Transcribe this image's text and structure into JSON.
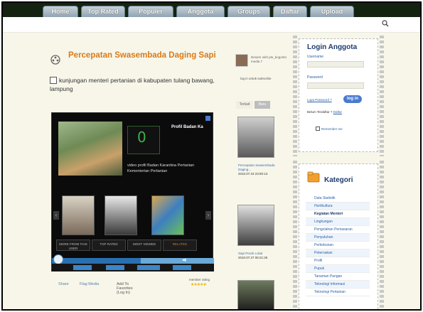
{
  "nav": {
    "tabs": [
      "Home",
      "Top Rated",
      "Populer",
      "Anggota",
      "Groups",
      "Daftar",
      "Upload"
    ]
  },
  "video": {
    "title": "Percepatan Swasembada Daging Sapi",
    "description": "kunjungan menteri pertanian di kabupaten tulang bawang, lampung"
  },
  "player": {
    "profile_title": "Profil Badan Ka",
    "featured_caption": "video profil Badan Karantina Pertanian Kementerian Pertanian",
    "tabs": [
      "MORE FROM THIS USER",
      "TOP RATED",
      "MOST VIEWED",
      "RELATED"
    ],
    "progress": 0.55
  },
  "below_player": {
    "share": "Share",
    "flag": "Flag Media",
    "add_favorites": "Add To Favorites (Log In)",
    "member_rating": "member rating",
    "stars": "★★★★★"
  },
  "uploader": {
    "text": "Desem oleh pts_bogortin media 7",
    "login_subscribe": "log in untuk subscribe"
  },
  "side_tabs": [
    "Terkait",
    "Baru"
  ],
  "side_videos": [
    {
      "title": "Percepatan Swasembada Daging...",
      "date": "2010.07.23 23:50:13"
    },
    {
      "title": "Sapi Perah Lokal",
      "date": "2010.07.27 06:21:26"
    }
  ],
  "login": {
    "title": "Login Anggota",
    "username_label": "Username",
    "password_label": "Password",
    "forgot": "Lupa Password ?",
    "button": "log in",
    "register_text": "Belum Terdaftar ?",
    "register_link": "Daftar",
    "remember": "Remember me"
  },
  "kategori": {
    "title": "Kategori",
    "items": [
      "Data Statistik",
      "Hortikultura",
      "Kegiatan Menteri",
      "Lingkungan",
      "Pengolahan Pemasaran",
      "Penyuluhan",
      "Perkebunan",
      "Peternakan",
      "Profil",
      "Pupuk",
      "Tanaman Pangan",
      "Teknologi Informasi",
      "Teknologi Pertanian"
    ]
  },
  "colors": {
    "nav_bg": "#14230f",
    "title_orange": "#d97a1a",
    "link_blue": "#2a5fa8",
    "page_bg": "#f7f6e9"
  }
}
